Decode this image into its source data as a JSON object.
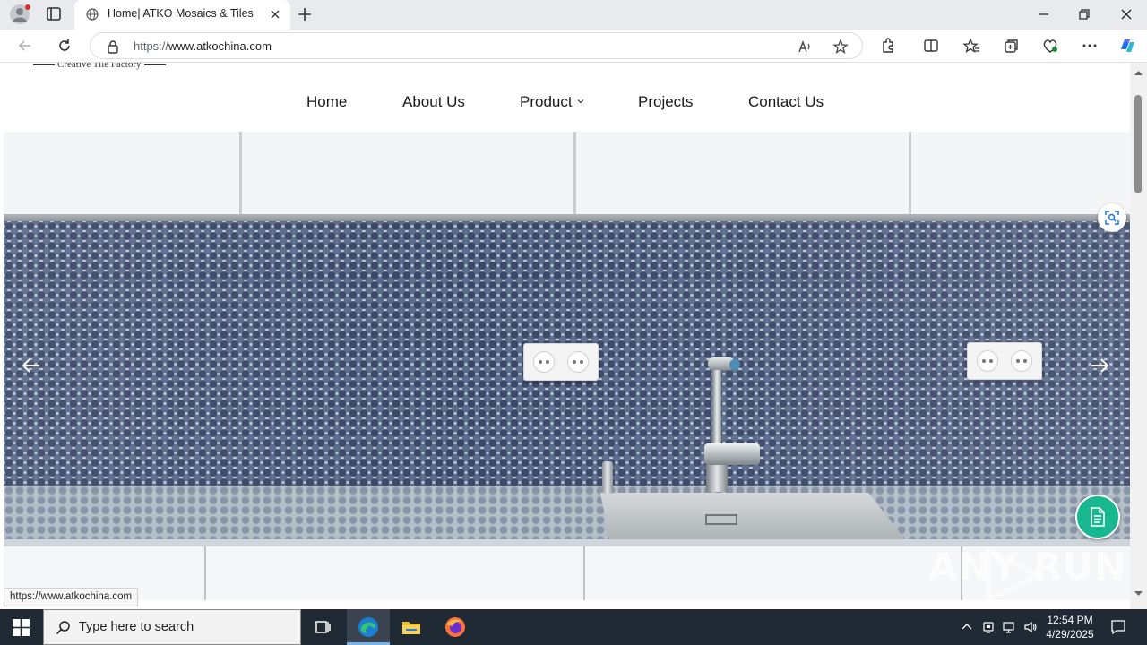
{
  "browser": {
    "tab_title": "Home| ATKO Mosaics & Tiles",
    "url_scheme": "https://",
    "url_host": "www.atkochina.com"
  },
  "site": {
    "tagline": "Creative Tile Factory",
    "menu": [
      {
        "label": "Home"
      },
      {
        "label": "About Us"
      },
      {
        "label": "Product"
      },
      {
        "label": "Projects"
      },
      {
        "label": "Contact Us"
      }
    ],
    "watermark": "ANY RUN"
  },
  "status_tooltip": "https://www.atkochina.com",
  "taskbar": {
    "search_placeholder": "Type here to search",
    "time": "12:54 PM",
    "date": "4/29/2025"
  },
  "colors": {
    "accent_green": "#17b890",
    "taskbar": "#1f2a35",
    "mosaic_blue": "#3a4868"
  },
  "icons": [
    "windows-start-icon",
    "search-icon",
    "task-view-icon",
    "edge-icon",
    "file-explorer-icon",
    "firefox-icon",
    "chevron-up-icon",
    "network-icon",
    "volume-icon",
    "notification-icon",
    "document-icon",
    "visual-search-icon"
  ]
}
